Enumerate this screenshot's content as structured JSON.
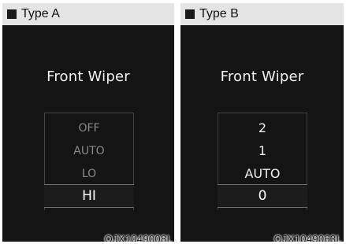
{
  "panel_a": {
    "header": "Type A",
    "title": "Front Wiper",
    "options": [
      "OFF",
      "AUTO",
      "LO"
    ],
    "selected": "HI",
    "code": "OJX1049008L"
  },
  "panel_b": {
    "header": "Type B",
    "title": "Front Wiper",
    "options": [
      "2",
      "1",
      "AUTO"
    ],
    "selected": "0",
    "code": "OJX1049063L"
  }
}
